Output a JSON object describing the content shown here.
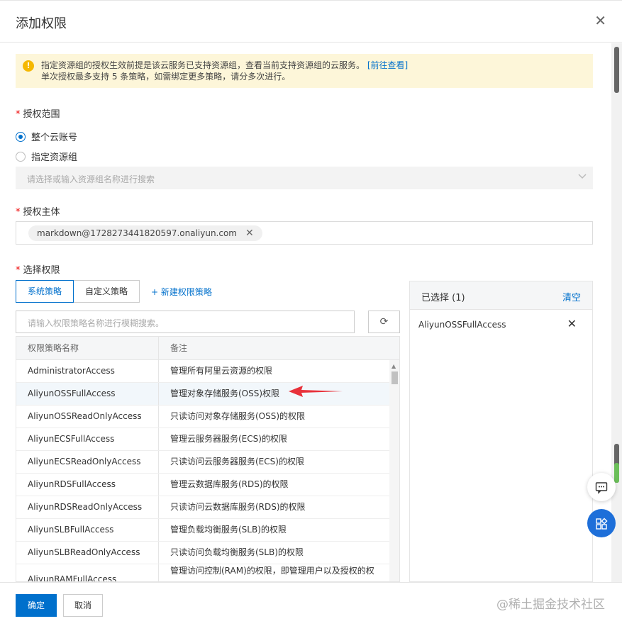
{
  "dialog": {
    "title": "添加权限",
    "close_icon": "close-icon"
  },
  "notice": {
    "line1": "指定资源组的授权生效前提是该云服务已支持资源组，查看当前支持资源组的云服务。",
    "link": "[前往查看]",
    "line2": "单次授权最多支持 5 条策略，如需绑定更多策略，请分多次进行。",
    "icon": "warning-icon",
    "color": "#fdf6d9"
  },
  "scope": {
    "label": "授权范围",
    "options": [
      "整个云账号",
      "指定资源组"
    ],
    "selected": "整个云账号",
    "select_placeholder": "请选择或输入资源组名称进行搜索"
  },
  "principal": {
    "label": "授权主体",
    "tag": "markdown@1728273441820597.onaliyun.com"
  },
  "permissions": {
    "label": "选择权限",
    "tabs": [
      "系统策略",
      "自定义策略"
    ],
    "active_tab": "系统策略",
    "new_policy": "+ 新建权限策略",
    "search_placeholder": "请输入权限策略名称进行模糊搜索。",
    "columns": [
      "权限策略名称",
      "备注"
    ],
    "rows": [
      {
        "name": "AdministratorAccess",
        "note": "管理所有阿里云资源的权限"
      },
      {
        "name": "AliyunOSSFullAccess",
        "note": "管理对象存储服务(OSS)权限"
      },
      {
        "name": "AliyunOSSReadOnlyAccess",
        "note": "只读访问对象存储服务(OSS)的权限"
      },
      {
        "name": "AliyunECSFullAccess",
        "note": "管理云服务器服务(ECS)的权限"
      },
      {
        "name": "AliyunECSReadOnlyAccess",
        "note": "只读访问云服务器服务(ECS)的权限"
      },
      {
        "name": "AliyunRDSFullAccess",
        "note": "管理云数据库服务(RDS)的权限"
      },
      {
        "name": "AliyunRDSReadOnlyAccess",
        "note": "只读访问云数据库服务(RDS)的权限"
      },
      {
        "name": "AliyunSLBFullAccess",
        "note": "管理负载均衡服务(SLB)的权限"
      },
      {
        "name": "AliyunSLBReadOnlyAccess",
        "note": "只读访问负载均衡服务(SLB)的权限"
      },
      {
        "name": "AliyunRAMFullAccess",
        "note": "管理访问控制(RAM)的权限，即管理用户以及授权的权"
      }
    ]
  },
  "selected": {
    "title": "已选择 (1)",
    "clear": "清空",
    "items": [
      "AliyunOSSFullAccess"
    ]
  },
  "footer": {
    "ok": "确定",
    "cancel": "取消"
  },
  "watermark": "@稀土掘金技术社区",
  "colors": {
    "primary": "#0070cc",
    "arrow": "#e8313a",
    "float_button": "#1e6fd9"
  }
}
